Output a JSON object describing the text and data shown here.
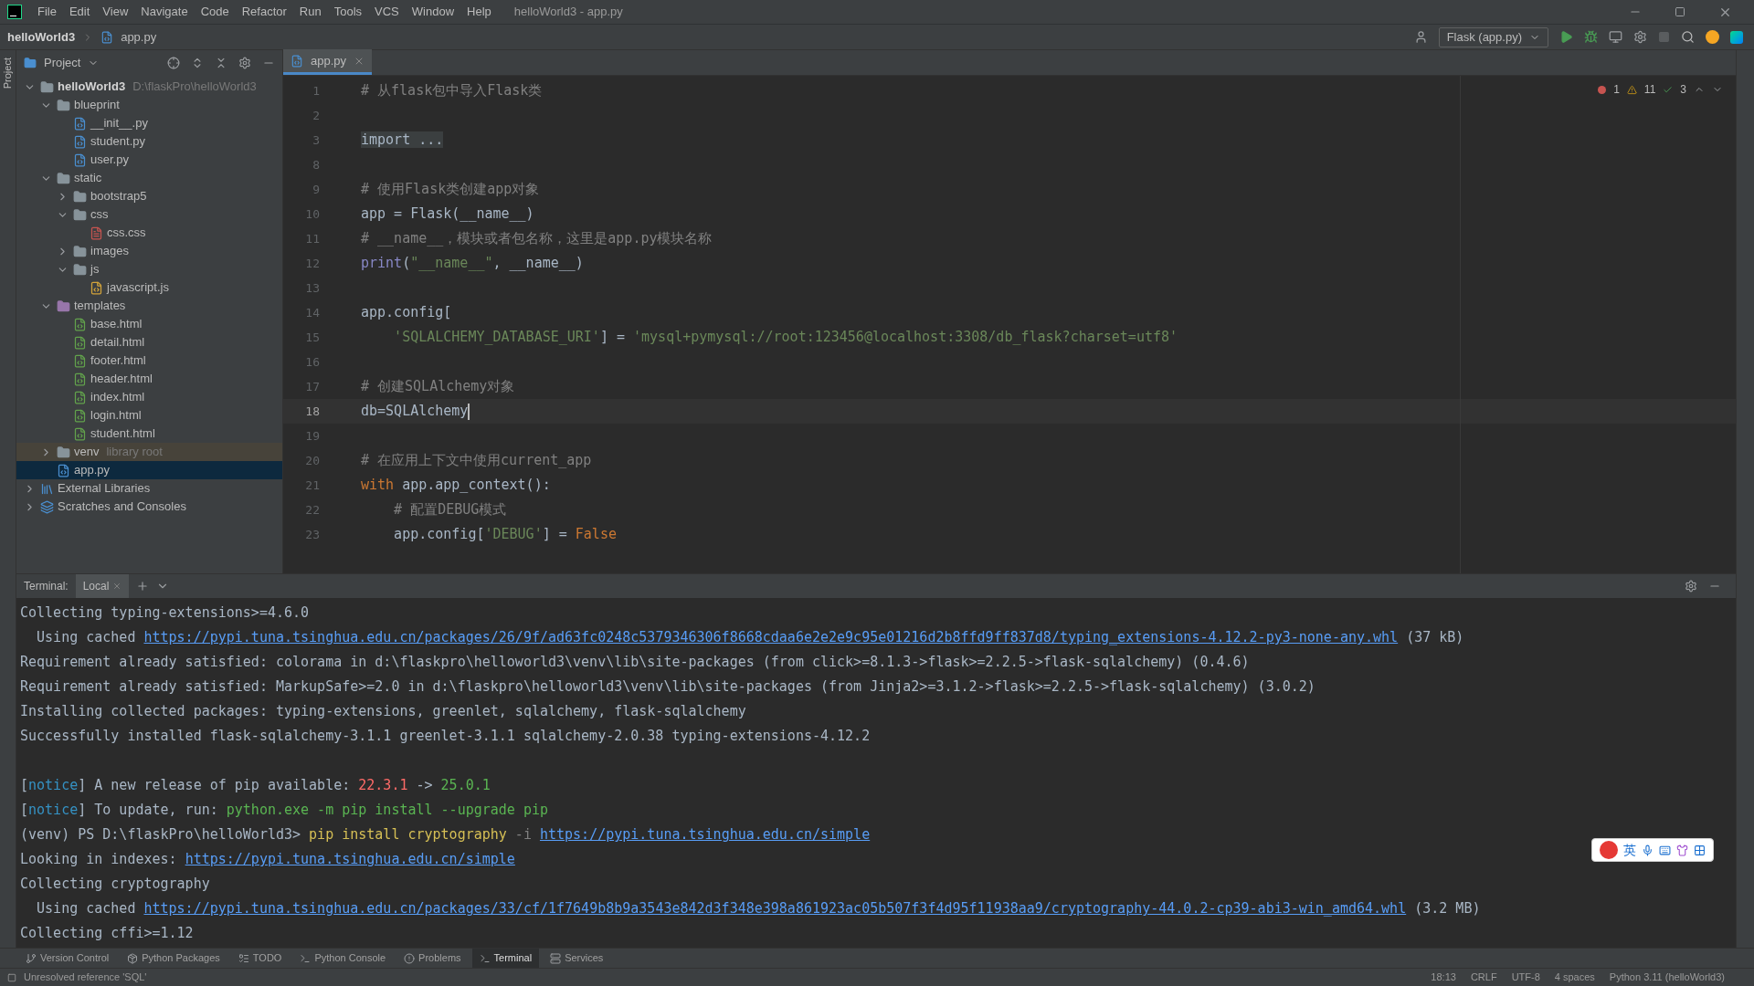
{
  "menu_bar": {
    "items": [
      "File",
      "Edit",
      "View",
      "Navigate",
      "Code",
      "Refactor",
      "Run",
      "Tools",
      "VCS",
      "Window",
      "Help"
    ],
    "title": "helloWorld3 - app.py"
  },
  "nav_bar": {
    "project": "helloWorld3",
    "file": "app.py",
    "run_config": "Flask (app.py)"
  },
  "left_stripe": {
    "label": "Project"
  },
  "project_panel": {
    "title": "Project"
  },
  "project_tree": {
    "items": [
      {
        "name": "helloWorld3",
        "kind": "folder",
        "hint": "D:\\flaskPro\\helloWorld3",
        "expanded": true,
        "selected": false,
        "children": [
          {
            "name": "blueprint",
            "kind": "folder",
            "expanded": true,
            "selected": false,
            "children": [
              {
                "name": "__init__.py",
                "kind": "python",
                "selected": false
              },
              {
                "name": "student.py",
                "kind": "python",
                "selected": false
              },
              {
                "name": "user.py",
                "kind": "python",
                "selected": false
              }
            ]
          },
          {
            "name": "static",
            "kind": "folder",
            "expanded": true,
            "selected": false,
            "children": [
              {
                "name": "bootstrap5",
                "kind": "folder",
                "expanded": false,
                "selected": false
              },
              {
                "name": "css",
                "kind": "folder",
                "expanded": true,
                "selected": false,
                "children": [
                  {
                    "name": "css.css",
                    "kind": "css",
                    "selected": false
                  }
                ]
              },
              {
                "name": "images",
                "kind": "folder",
                "expanded": false,
                "selected": false
              },
              {
                "name": "js",
                "kind": "folder",
                "expanded": true,
                "selected": false,
                "children": [
                  {
                    "name": "javascript.js",
                    "kind": "js",
                    "selected": false
                  }
                ]
              }
            ]
          },
          {
            "name": "templates",
            "kind": "templates",
            "expanded": true,
            "selected": false,
            "children": [
              {
                "name": "base.html",
                "kind": "html",
                "selected": false
              },
              {
                "name": "detail.html",
                "kind": "html",
                "selected": false
              },
              {
                "name": "footer.html",
                "kind": "html",
                "selected": false
              },
              {
                "name": "header.html",
                "kind": "html",
                "selected": false
              },
              {
                "name": "index.html",
                "kind": "html",
                "selected": false
              },
              {
                "name": "login.html",
                "kind": "html",
                "selected": false
              },
              {
                "name": "student.html",
                "kind": "html",
                "selected": false
              }
            ]
          },
          {
            "name": "venv",
            "kind": "venv",
            "hint": "library root",
            "expanded": false,
            "selected": false
          },
          {
            "name": "app.py",
            "kind": "python",
            "selected": true
          }
        ]
      },
      {
        "name": "External Libraries",
        "kind": "library",
        "expanded": false,
        "selected": false
      },
      {
        "name": "Scratches and Consoles",
        "kind": "scratch",
        "expanded": false,
        "selected": false
      }
    ]
  },
  "editor": {
    "tab": "app.py",
    "inspections": {
      "errors": "1",
      "warnings": "11",
      "weak": "3"
    },
    "lines": [
      {
        "number": "1",
        "current": false,
        "segments": [
          {
            "text": "# 从flask包中导入Flask类",
            "kind": "comment"
          }
        ]
      },
      {
        "number": "2",
        "current": false
      },
      {
        "number": "3",
        "current": false,
        "segments": [
          {
            "text": "import ...",
            "kind": "folded"
          }
        ]
      },
      {
        "number": "8",
        "current": false
      },
      {
        "number": "9",
        "current": false,
        "segments": [
          {
            "text": "# 使用Flask类创建app对象",
            "kind": "comment"
          }
        ]
      },
      {
        "number": "10",
        "current": false,
        "segments": [
          {
            "text": "app = Flask(__name__)",
            "kind": "plain"
          }
        ]
      },
      {
        "number": "11",
        "current": false,
        "segments": [
          {
            "text": "# __name__，模块或者包名称，这里是app.py模块名称",
            "kind": "comment"
          }
        ]
      },
      {
        "number": "12",
        "current": false,
        "segments": [
          {
            "text": "print",
            "kind": "builtin"
          },
          {
            "text": "(",
            "kind": "plain"
          },
          {
            "text": "\"__name__\"",
            "kind": "string"
          },
          {
            "text": ", __name__)",
            "kind": "plain"
          }
        ]
      },
      {
        "number": "13",
        "current": false
      },
      {
        "number": "14",
        "current": false,
        "segments": [
          {
            "text": "app.config[",
            "kind": "plain"
          }
        ]
      },
      {
        "number": "15",
        "current": false,
        "indented": true,
        "segments": [
          {
            "text": "'SQLALCHEMY_DATABASE_URI'",
            "kind": "string"
          },
          {
            "text": "] = ",
            "kind": "plain"
          },
          {
            "text": "'mysql+pymysql://root:123456@localhost:3308/db_flask?charset=utf8'",
            "kind": "string"
          }
        ]
      },
      {
        "number": "16",
        "current": false
      },
      {
        "number": "17",
        "current": false,
        "segments": [
          {
            "text": "# 创建SQLAlchemy对象",
            "kind": "comment"
          }
        ]
      },
      {
        "number": "18",
        "current": true,
        "segments": [
          {
            "text": "db=SQLAlchemy",
            "kind": "plain"
          }
        ]
      },
      {
        "number": "19",
        "current": false
      },
      {
        "number": "20",
        "current": false,
        "segments": [
          {
            "text": "# 在应用上下文中使用current_app",
            "kind": "comment"
          }
        ]
      },
      {
        "number": "21",
        "current": false,
        "segments": [
          {
            "text": "with",
            "kind": "keyword"
          },
          {
            "text": " app.app_context():",
            "kind": "plain"
          }
        ]
      },
      {
        "number": "22",
        "current": false,
        "indented": true,
        "segments": [
          {
            "text": "# 配置DEBUG模式",
            "kind": "comment"
          }
        ]
      },
      {
        "number": "23",
        "current": false,
        "indented": true,
        "segments": [
          {
            "text": "app.config[",
            "kind": "plain"
          },
          {
            "text": "'DEBUG'",
            "kind": "string"
          },
          {
            "text": "] = ",
            "kind": "plain"
          },
          {
            "text": "False",
            "kind": "keyword"
          }
        ]
      }
    ]
  },
  "terminal": {
    "title": "Terminal:",
    "tabs": [
      {
        "label": "Local",
        "selected": true
      }
    ],
    "lines": [
      {
        "kind": "text",
        "segments": [
          {
            "text": "Collecting typing-extensions>=4.6.0",
            "kind": "plain"
          }
        ]
      },
      {
        "kind": "text",
        "segments": [
          {
            "text": "  Using cached ",
            "kind": "plain"
          },
          {
            "text": "https://pypi.tuna.tsinghua.edu.cn/packages/26/9f/ad63fc0248c5379346306f8668cdaa6e2e2e9c95e01216d2b8ffd9ff837d8/typing_extensions-4.12.2-py3-none-any.whl",
            "kind": "link"
          },
          {
            "text": " (37 kB)",
            "kind": "plain"
          }
        ]
      },
      {
        "kind": "text",
        "segments": [
          {
            "text": "Requirement already satisfied: colorama in d:\\flaskpro\\helloworld3\\venv\\lib\\site-packages (from click>=8.1.3->flask>=2.2.5->flask-sqlalchemy) (0.4.6)",
            "kind": "plain"
          }
        ]
      },
      {
        "kind": "text",
        "segments": [
          {
            "text": "Requirement already satisfied: MarkupSafe>=2.0 in d:\\flaskpro\\helloworld3\\venv\\lib\\site-packages (from Jinja2>=3.1.2->flask>=2.2.5->flask-sqlalchemy) (3.0.2)",
            "kind": "plain"
          }
        ]
      },
      {
        "kind": "text",
        "segments": [
          {
            "text": "Installing collected packages: typing-extensions, greenlet, sqlalchemy, flask-sqlalchemy",
            "kind": "plain"
          }
        ]
      },
      {
        "kind": "text",
        "segments": [
          {
            "text": "Successfully installed flask-sqlalchemy-3.1.1 greenlet-3.1.1 sqlalchemy-2.0.38 typing-extensions-4.12.2",
            "kind": "plain"
          }
        ]
      },
      {
        "kind": "blank"
      },
      {
        "kind": "text",
        "segments": [
          {
            "text": "[",
            "kind": "plain"
          },
          {
            "text": "notice",
            "kind": "notice"
          },
          {
            "text": "] A new release of pip available: ",
            "kind": "plain"
          },
          {
            "text": "22.3.1",
            "kind": "error"
          },
          {
            "text": " -> ",
            "kind": "plain"
          },
          {
            "text": "25.0.1",
            "kind": "success"
          }
        ]
      },
      {
        "kind": "text",
        "segments": [
          {
            "text": "[",
            "kind": "plain"
          },
          {
            "text": "notice",
            "kind": "notice"
          },
          {
            "text": "] To update, run: ",
            "kind": "plain"
          },
          {
            "text": "python.exe -m pip install --upgrade pip",
            "kind": "success"
          }
        ]
      },
      {
        "kind": "text",
        "segments": [
          {
            "text": "(venv) PS D:\\flaskPro\\helloWorld3> ",
            "kind": "plain"
          },
          {
            "text": "pip install cryptography",
            "kind": "command"
          },
          {
            "text": " -i ",
            "kind": "option"
          },
          {
            "text": "https://pypi.tuna.tsinghua.edu.cn/simple",
            "kind": "link"
          }
        ]
      },
      {
        "kind": "text",
        "segments": [
          {
            "text": "Looking in indexes: ",
            "kind": "plain"
          },
          {
            "text": "https://pypi.tuna.tsinghua.edu.cn/simple",
            "kind": "link"
          }
        ]
      },
      {
        "kind": "text",
        "segments": [
          {
            "text": "Collecting cryptography",
            "kind": "plain"
          }
        ]
      },
      {
        "kind": "text",
        "segments": [
          {
            "text": "  Using cached ",
            "kind": "plain"
          },
          {
            "text": "https://pypi.tuna.tsinghua.edu.cn/packages/33/cf/1f7649b8b9a3543e842d3f348e398a861923ac05b507f3f4d95f11938aa9/cryptography-44.0.2-cp39-abi3-win_amd64.whl",
            "kind": "link"
          },
          {
            "text": " (3.2 MB)",
            "kind": "plain"
          }
        ]
      },
      {
        "kind": "text",
        "segments": [
          {
            "text": "Collecting cffi>=1.12",
            "kind": "plain"
          }
        ]
      }
    ]
  },
  "ime_toolbar": {
    "label": "英"
  },
  "tool_tabs": [
    {
      "label": "Version Control",
      "kind": "vcs",
      "selected": false
    },
    {
      "label": "Python Packages",
      "kind": "packages",
      "selected": false
    },
    {
      "label": "TODO",
      "kind": "todo",
      "selected": false
    },
    {
      "label": "Python Console",
      "kind": "console",
      "selected": false
    },
    {
      "label": "Problems",
      "kind": "problems",
      "selected": false
    },
    {
      "label": "Terminal",
      "kind": "terminal",
      "selected": true
    },
    {
      "label": "Services",
      "kind": "services",
      "selected": false
    }
  ],
  "status_bar": {
    "message": "Unresolved reference 'SQL'",
    "items": [
      "18:13",
      "CRLF",
      "UTF-8",
      "4 spaces",
      "Python 3.11 (helloWorld3)"
    ]
  }
}
